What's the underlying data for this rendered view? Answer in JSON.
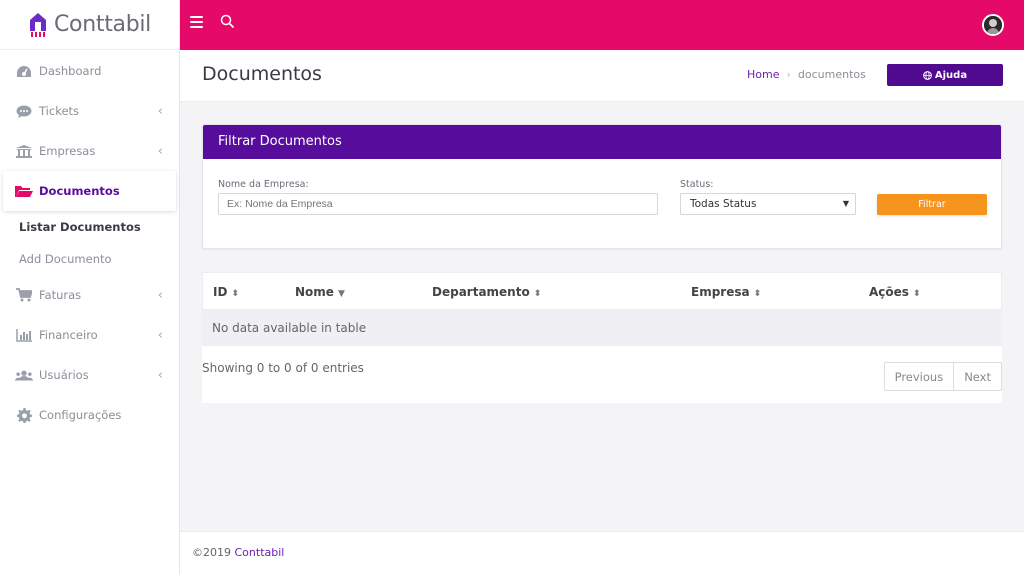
{
  "app": {
    "brand": "Conttabil",
    "colors": {
      "topbar": "#e5096a",
      "primary": "#570d9c",
      "accent": "#f7941d"
    }
  },
  "sidebar": {
    "items": [
      {
        "label": "Dashboard",
        "icon": "dashboard-icon",
        "has_chevron": false
      },
      {
        "label": "Tickets",
        "icon": "comment-icon",
        "has_chevron": true
      },
      {
        "label": "Empresas",
        "icon": "bank-icon",
        "has_chevron": true
      },
      {
        "label": "Documentos",
        "icon": "folder-open-icon",
        "has_chevron": false,
        "active": true
      },
      {
        "label": "Faturas",
        "icon": "cart-icon",
        "has_chevron": true
      },
      {
        "label": "Financeiro",
        "icon": "bar-chart-icon",
        "has_chevron": true
      },
      {
        "label": "Usuários",
        "icon": "users-icon",
        "has_chevron": true
      },
      {
        "label": "Configurações",
        "icon": "gear-icon",
        "has_chevron": false
      }
    ],
    "subitems": [
      {
        "label": "Listar Documentos",
        "current": true
      },
      {
        "label": "Add Documento",
        "current": false
      }
    ]
  },
  "header": {
    "title": "Documentos",
    "breadcrumb": {
      "home": "Home",
      "current": "documentos"
    },
    "help_label": "Ajuda"
  },
  "filter": {
    "title": "Filtrar Documentos",
    "company_label": "Nome da Empresa:",
    "company_placeholder": "Ex: Nome da Empresa",
    "status_label": "Status:",
    "status_value": "Todas Status",
    "button_label": "Filtrar"
  },
  "table": {
    "columns": [
      "ID",
      "Nome",
      "Departamento",
      "Empresa",
      "Ações"
    ],
    "empty_text": "No data available in table",
    "info": "Showing 0 to 0 of 0 entries",
    "prev_label": "Previous",
    "next_label": "Next"
  },
  "footer": {
    "copyright": "©2019",
    "brand": "Conttabil"
  }
}
